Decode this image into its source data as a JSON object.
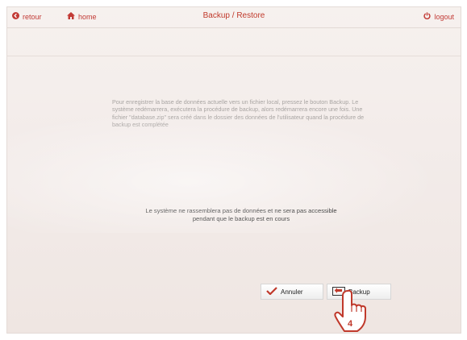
{
  "header": {
    "back_label": "retour",
    "home_label": "home",
    "title": "Backup / Restore",
    "logout_label": "logout"
  },
  "main": {
    "info_text": "Pour enregistrer la base de données actuelle vers un fichier local, pressez le bouton Backup. Le système redémarrera, exécutera la procédure de backup, alors redémarrera encore une fois. Une fichier \"database.zip\" sera créé dans le dossier des données de l'utilisateur quand la procédure de backup est complétée",
    "warning_line1": "Le système ne rassemblera pas de données et ne sera pas accessible",
    "warning_line2": "pendant que le backup est en cours"
  },
  "buttons": {
    "cancel_label": "Annuler",
    "backup_label": "Backup"
  },
  "annotation": {
    "step_number": "4"
  },
  "colors": {
    "accent": "#c0392b",
    "background": "#f3ecea"
  }
}
